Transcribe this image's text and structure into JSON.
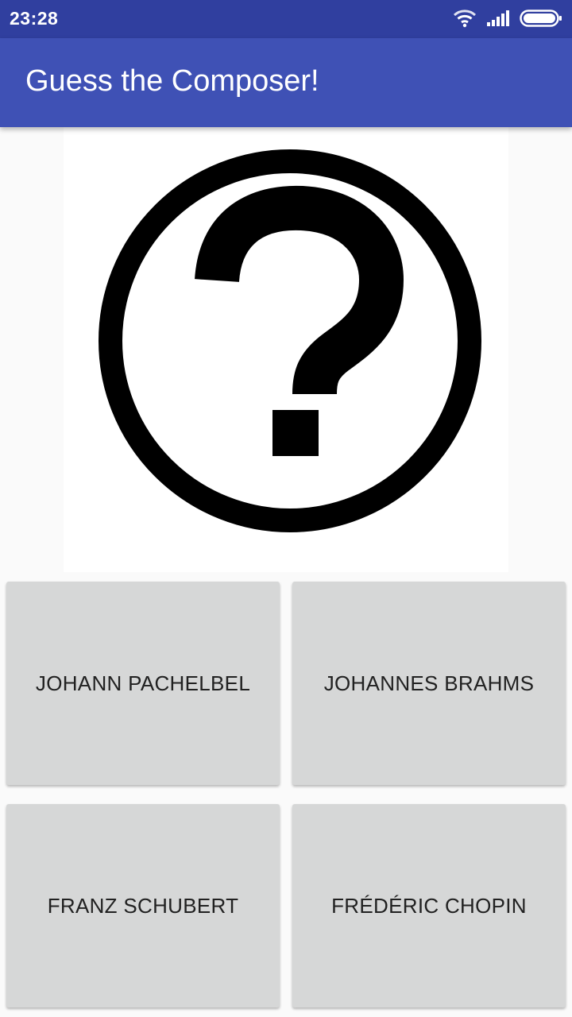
{
  "status_bar": {
    "time": "23:28",
    "icons": [
      "wifi-icon",
      "signal-icon",
      "battery-icon"
    ]
  },
  "app_bar": {
    "title": "Guess the Composer!",
    "color": "#3f51b5",
    "status_color": "#303f9f"
  },
  "composer_image": {
    "icon": "question-mark-icon"
  },
  "answers": [
    {
      "label": "JOHANN PACHELBEL"
    },
    {
      "label": "JOHANNES BRAHMS"
    },
    {
      "label": "FRANZ SCHUBERT"
    },
    {
      "label": "FRÉDÉRIC CHOPIN"
    }
  ]
}
